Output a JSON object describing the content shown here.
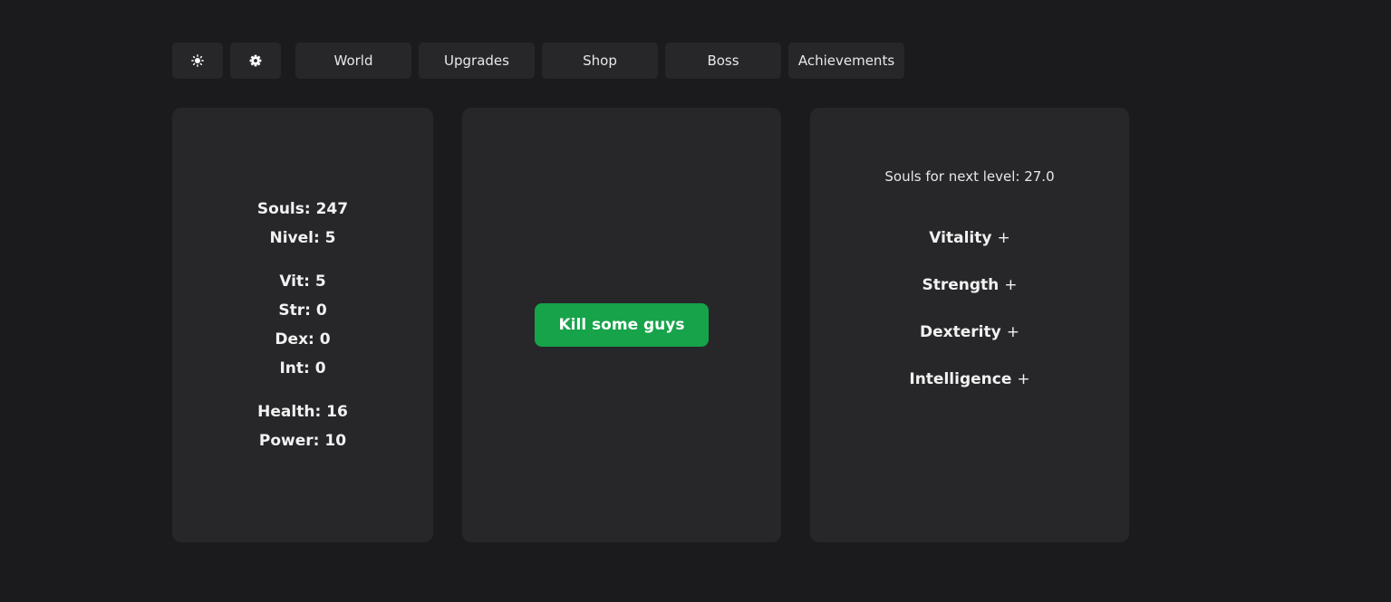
{
  "nav": {
    "theme_icon": "sun-icon",
    "settings_icon": "gear-icon",
    "tabs": [
      {
        "label": "World"
      },
      {
        "label": "Upgrades"
      },
      {
        "label": "Shop"
      },
      {
        "label": "Boss"
      },
      {
        "label": "Achievements"
      }
    ]
  },
  "stats": {
    "souls": "Souls: 247",
    "nivel": "Nivel: 5",
    "vit": "Vit: 5",
    "str": "Str: 0",
    "dex": "Dex: 0",
    "int": "Int: 0",
    "health": "Health: 16",
    "power": "Power: 10"
  },
  "action": {
    "kill_label": "Kill some guys"
  },
  "levelup": {
    "next_level_text": "Souls for next level: 27.0",
    "attributes": [
      {
        "name": "Vitality",
        "plus": "+"
      },
      {
        "name": "Strength",
        "plus": "+"
      },
      {
        "name": "Dexterity",
        "plus": "+"
      },
      {
        "name": "Intelligence",
        "plus": "+"
      }
    ]
  },
  "colors": {
    "background": "#1b1b1d",
    "panel": "#27272a",
    "accent_green": "#16a34a"
  }
}
